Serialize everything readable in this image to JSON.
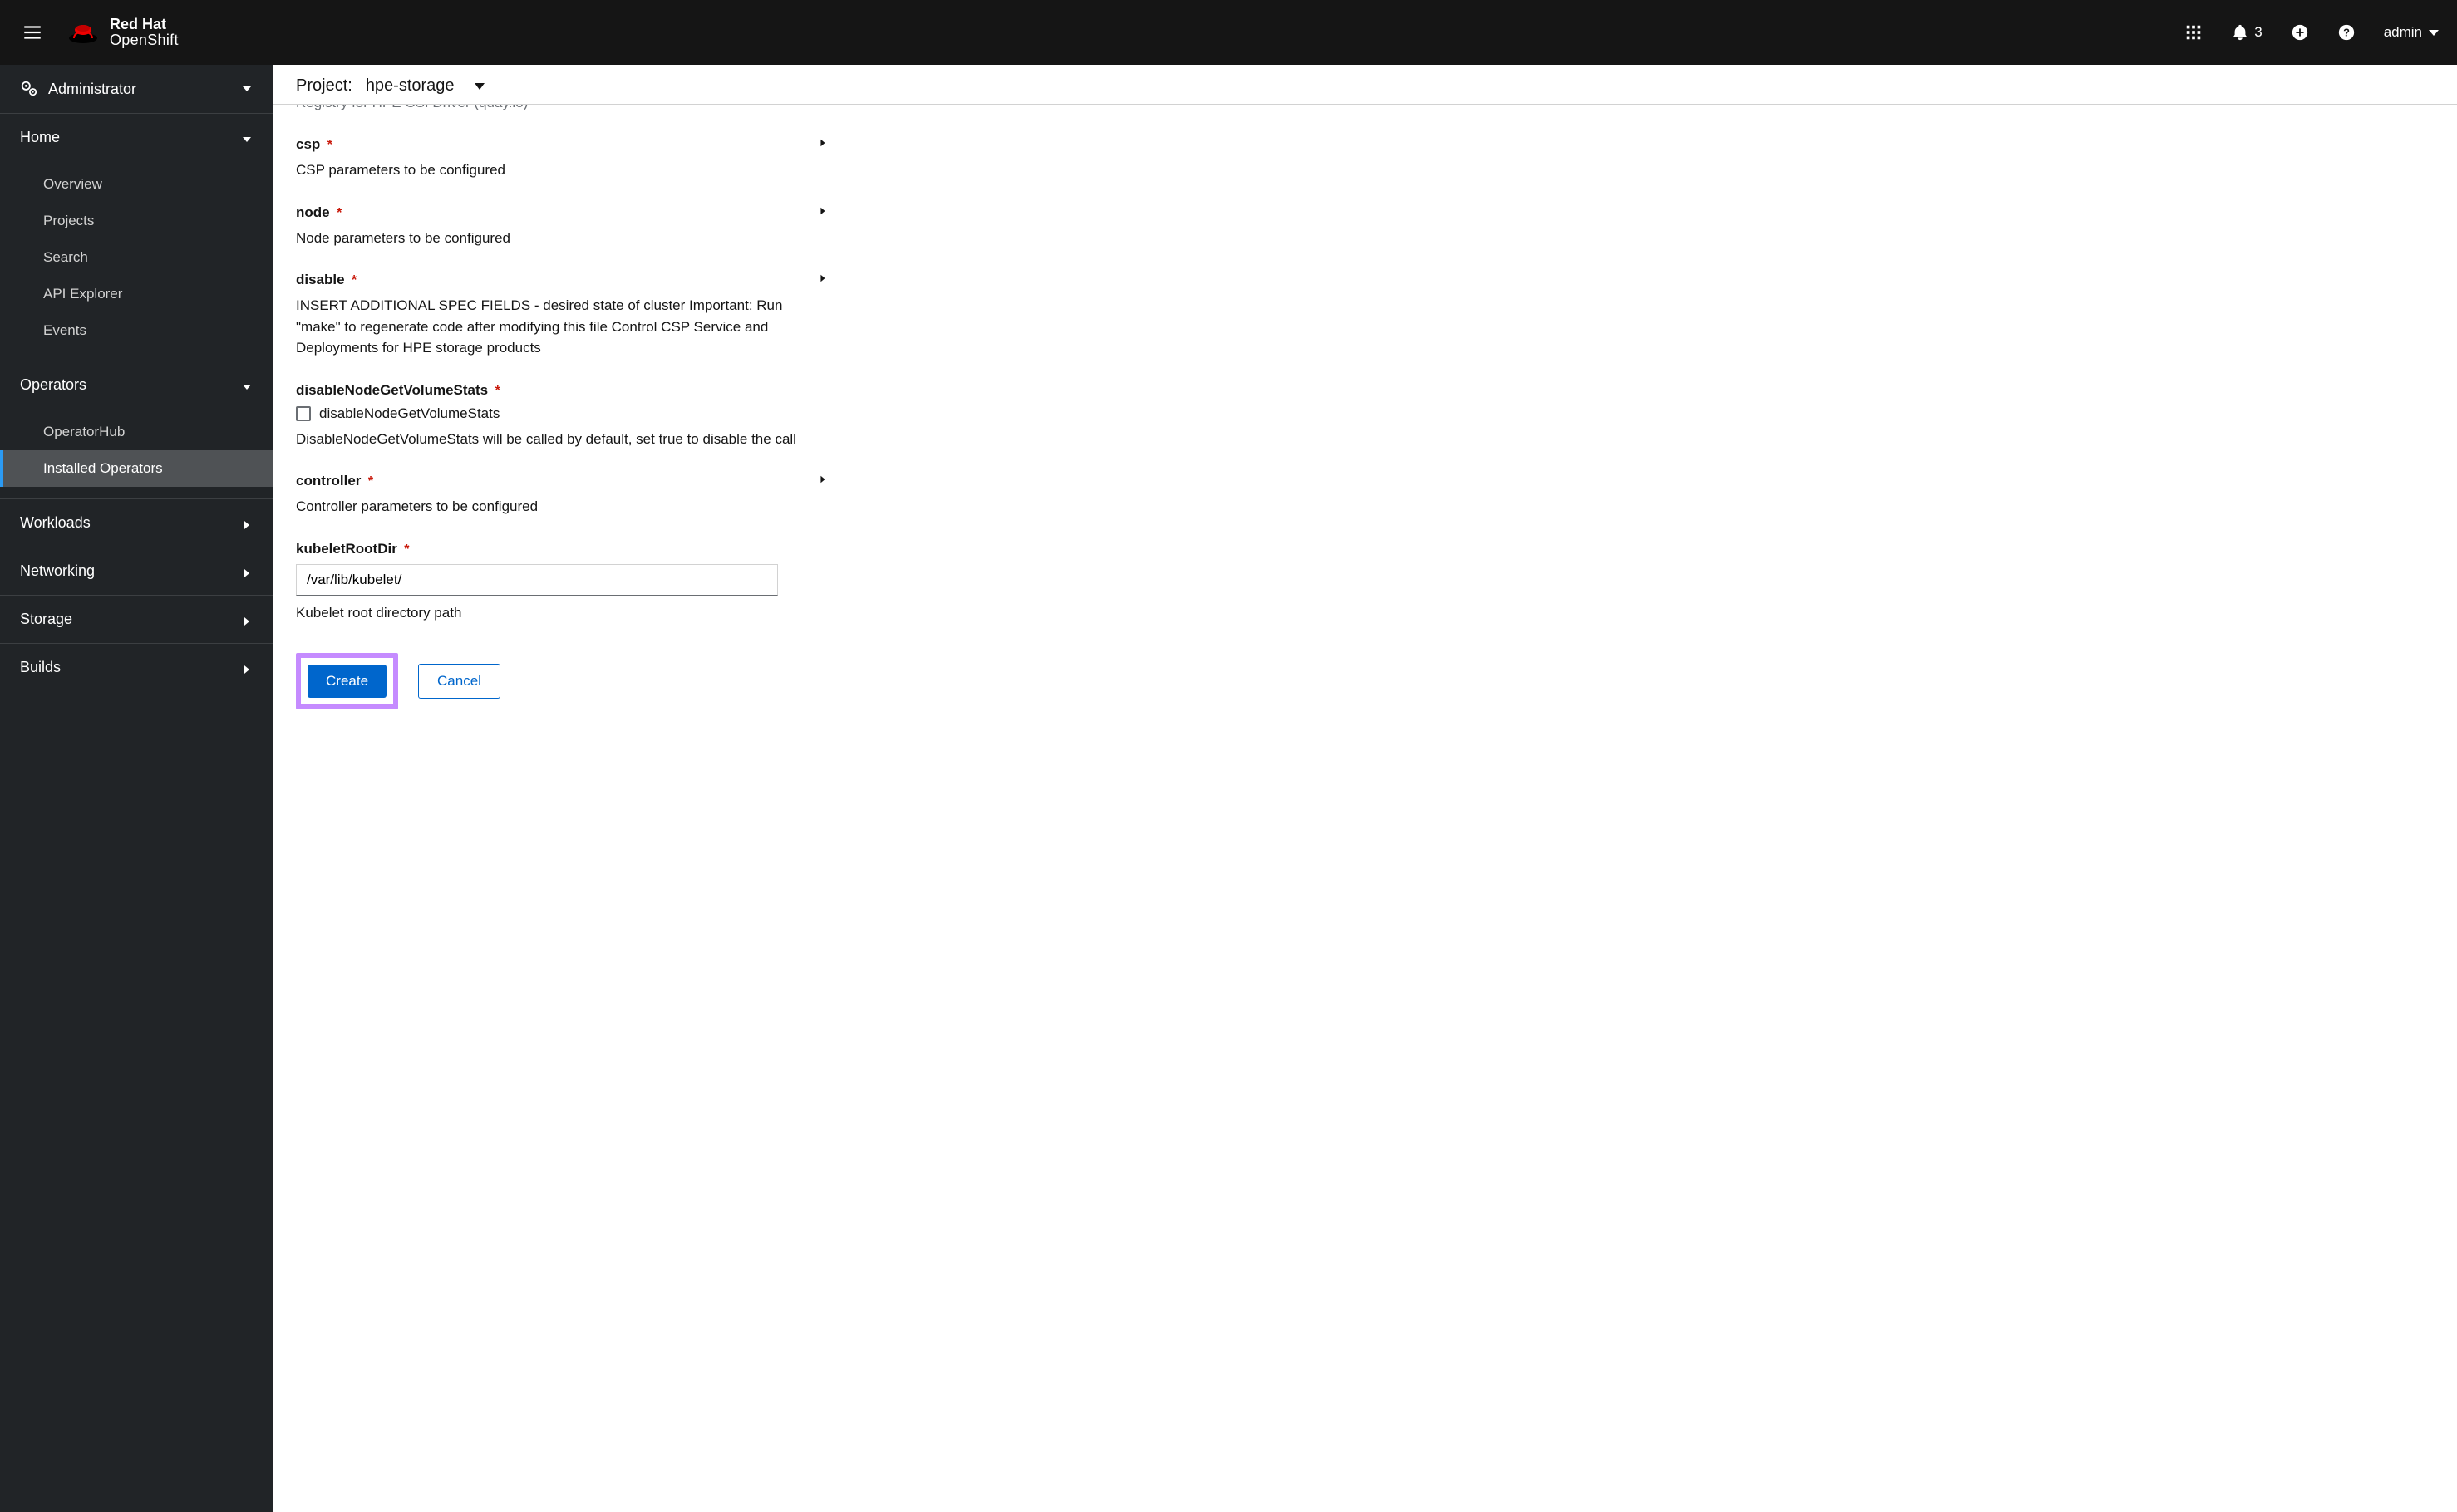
{
  "masthead": {
    "brand_line1": "Red Hat",
    "brand_line2": "OpenShift",
    "alert_count": "3",
    "user_label": "admin"
  },
  "sidebar": {
    "perspective_label": "Administrator",
    "sections": {
      "home": {
        "label": "Home",
        "items": [
          "Overview",
          "Projects",
          "Search",
          "API Explorer",
          "Events"
        ]
      },
      "operators": {
        "label": "Operators",
        "items": [
          "OperatorHub",
          "Installed Operators"
        ]
      },
      "workloads": {
        "label": "Workloads"
      },
      "networking": {
        "label": "Networking"
      },
      "storage": {
        "label": "Storage"
      },
      "builds": {
        "label": "Builds"
      }
    }
  },
  "project_bar": {
    "prefix": "Project:",
    "value": "hpe-storage"
  },
  "form": {
    "clipped_top": "Registry for HPE CSI Driver (quay.io)",
    "csp": {
      "title": "csp",
      "desc": "CSP parameters to be configured"
    },
    "node": {
      "title": "node",
      "desc": "Node parameters to be configured"
    },
    "disable": {
      "title": "disable",
      "desc": "INSERT ADDITIONAL SPEC FIELDS - desired state of cluster Important: Run \"make\" to regenerate code after modifying this file Control CSP Service and Deployments for HPE storage products"
    },
    "disableNodeGetVolumeStats": {
      "title": "disableNodeGetVolumeStats",
      "checkbox_label": "disableNodeGetVolumeStats",
      "desc": "DisableNodeGetVolumeStats will be called by default, set true to disable the call"
    },
    "controller": {
      "title": "controller",
      "desc": "Controller parameters to be configured"
    },
    "kubeletRootDir": {
      "title": "kubeletRootDir",
      "value": "/var/lib/kubelet/",
      "desc": "Kubelet root directory path"
    },
    "actions": {
      "create": "Create",
      "cancel": "Cancel"
    }
  }
}
